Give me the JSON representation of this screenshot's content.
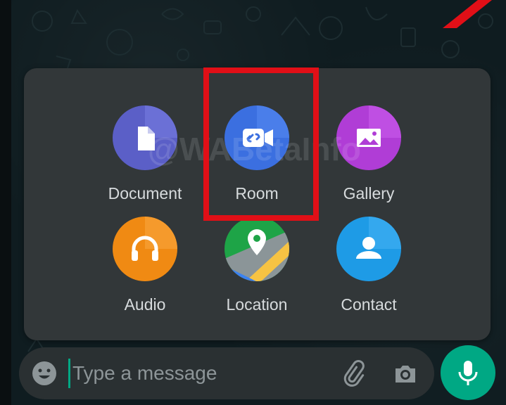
{
  "attach_menu": {
    "items": [
      {
        "id": "document",
        "label": "Document",
        "color": "#5b5fc7",
        "icon": "document-icon"
      },
      {
        "id": "room",
        "label": "Room",
        "color": "#3b6fe0",
        "icon": "video-link-icon"
      },
      {
        "id": "gallery",
        "label": "Gallery",
        "color": "#b03dd6",
        "icon": "image-icon"
      },
      {
        "id": "audio",
        "label": "Audio",
        "color": "#f08a13",
        "icon": "headphones-icon"
      },
      {
        "id": "location",
        "label": "Location",
        "color": "#1ea447",
        "icon": "map-pin-icon"
      },
      {
        "id": "contact",
        "label": "Contact",
        "color": "#1e9be6",
        "icon": "person-icon"
      }
    ]
  },
  "watermark": "@WABetaInfo",
  "composer": {
    "placeholder": "Type a message",
    "accent": "#00a884"
  },
  "highlight_color": "#e10f17"
}
